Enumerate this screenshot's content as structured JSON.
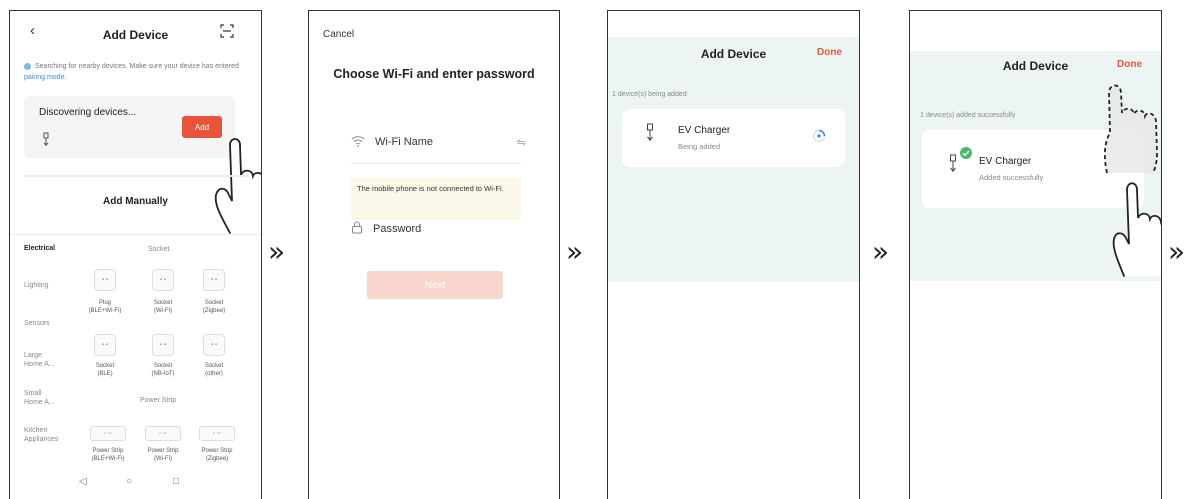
{
  "arrow_glyph": "»",
  "screen1": {
    "title": "Add Device",
    "scan_text": "Searching for nearby devices. Make sure your device has entered",
    "pairing_link": "pairing mode",
    "pairing_suffix": ".",
    "discovering": "Discovering devices...",
    "add_button": "Add",
    "add_manually": "Add Manually",
    "categories": [
      "Electrical",
      "Lighting",
      "Sensors",
      "Large Home A...",
      "Small Home A...",
      "Kitchen Appliances"
    ],
    "section_socket": "Socket",
    "section_power_strip": "Power Strip",
    "devices": [
      {
        "line1": "Plug",
        "line2": "(BLE+Wi-Fi)"
      },
      {
        "line1": "Socket",
        "line2": "(Wi-Fi)"
      },
      {
        "line1": "Socket",
        "line2": "(Zigbee)"
      },
      {
        "line1": "Socket",
        "line2": "(BLE)"
      },
      {
        "line1": "Socket",
        "line2": "(NB-IoT)"
      },
      {
        "line1": "Socket",
        "line2": "(other)"
      },
      {
        "line1": "Power Strip",
        "line2": "(BLE+Wi-Fi)"
      },
      {
        "line1": "Power Strip",
        "line2": "(Wi-Fi)"
      },
      {
        "line1": "Power Strip",
        "line2": "(Zigbee)"
      }
    ]
  },
  "screen2": {
    "cancel": "Cancel",
    "heading": "Choose Wi-Fi and enter password",
    "wifi_name": "Wi-Fi Name",
    "warning": "The mobile phone is not connected to Wi-Fi.",
    "password": "Password",
    "next": "Next"
  },
  "screen3": {
    "title": "Add Device",
    "done": "Done",
    "status": "1 device(s) being added",
    "device_name": "EV Charger",
    "device_status": "Being added"
  },
  "screen4": {
    "title": "Add Device",
    "done": "Done",
    "status": "1 device(s) added successfully",
    "device_name": "EV Charger",
    "device_status": "Added successfully"
  },
  "colors": {
    "accent": "#e8543b",
    "link": "#3b86d8",
    "success": "#4cb86b",
    "panel_bg": "#edf5f4"
  }
}
